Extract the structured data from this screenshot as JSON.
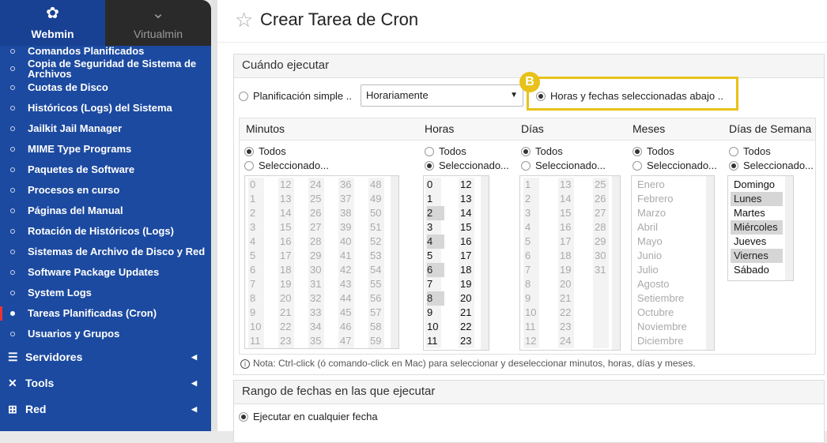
{
  "brand": {
    "webmin": "Webmin",
    "virtualmin": "Virtualmin"
  },
  "sidebar": {
    "items": [
      {
        "label": "Comandos Planificados"
      },
      {
        "label": "Copia de Seguridad de Sistema de Archivos"
      },
      {
        "label": "Cuotas de Disco"
      },
      {
        "label": "Históricos (Logs) del Sistema"
      },
      {
        "label": "Jailkit Jail Manager"
      },
      {
        "label": "MIME Type Programs"
      },
      {
        "label": "Paquetes de Software"
      },
      {
        "label": "Procesos en curso"
      },
      {
        "label": "Páginas del Manual"
      },
      {
        "label": "Rotación de Históricos (Logs)"
      },
      {
        "label": "Sistemas de Archivo de Disco y Red"
      },
      {
        "label": "Software Package Updates"
      },
      {
        "label": "System Logs"
      },
      {
        "label": "Tareas Planificadas (Cron)",
        "active": true
      },
      {
        "label": "Usuarios y Grupos"
      }
    ],
    "groups": [
      {
        "label": "Servidores",
        "icon": "server-icon"
      },
      {
        "label": "Tools",
        "icon": "tools-icon"
      },
      {
        "label": "Red",
        "icon": "network-icon"
      }
    ]
  },
  "page": {
    "title": "Crear Tarea de Cron"
  },
  "when": {
    "heading": "Cuándo ejecutar",
    "simple_label": "Planificación simple ..",
    "simple_value": "Horariamente",
    "selected_label": "Horas y fechas seleccionadas abajo ..",
    "badge": "B",
    "columns": {
      "minutes": "Minutos",
      "hours": "Horas",
      "days": "Días",
      "months": "Meses",
      "weekdays": "Días de Semana"
    },
    "todos": "Todos",
    "seleccionado": "Seleccionado...",
    "minutes_cols": [
      [
        "0",
        "1",
        "2",
        "3",
        "4",
        "5",
        "6",
        "7",
        "8",
        "9",
        "10",
        "11"
      ],
      [
        "12",
        "13",
        "14",
        "15",
        "16",
        "17",
        "18",
        "19",
        "20",
        "21",
        "22",
        "23"
      ],
      [
        "24",
        "25",
        "26",
        "27",
        "28",
        "29",
        "30",
        "31",
        "32",
        "33",
        "34",
        "35"
      ],
      [
        "36",
        "37",
        "38",
        "39",
        "40",
        "41",
        "42",
        "43",
        "44",
        "45",
        "46",
        "47"
      ],
      [
        "48",
        "49",
        "50",
        "51",
        "52",
        "53",
        "54",
        "55",
        "56",
        "57",
        "58",
        "59"
      ]
    ],
    "hours_cols": [
      [
        "0",
        "1",
        "2",
        "3",
        "4",
        "5",
        "6",
        "7",
        "8",
        "9",
        "10",
        "11"
      ],
      [
        "12",
        "13",
        "14",
        "15",
        "16",
        "17",
        "18",
        "19",
        "20",
        "21",
        "22",
        "23"
      ]
    ],
    "hours_selected": [
      "2",
      "4",
      "6",
      "8"
    ],
    "days_cols": [
      [
        "1",
        "2",
        "3",
        "4",
        "5",
        "6",
        "7",
        "8",
        "9",
        "10",
        "11",
        "12"
      ],
      [
        "13",
        "14",
        "15",
        "16",
        "17",
        "18",
        "19",
        "20",
        "21",
        "22",
        "23",
        "24"
      ],
      [
        "25",
        "26",
        "27",
        "28",
        "29",
        "30",
        "31"
      ]
    ],
    "months": [
      "Enero",
      "Febrero",
      "Marzo",
      "Abril",
      "Mayo",
      "Junio",
      "Julio",
      "Agosto",
      "Setiembre",
      "Octubre",
      "Noviembre",
      "Diciembre"
    ],
    "weekdays": [
      "Domingo",
      "Lunes",
      "Martes",
      "Miércoles",
      "Jueves",
      "Viernes",
      "Sábado"
    ],
    "weekdays_selected": [
      "Lunes",
      "Miércoles",
      "Viernes"
    ],
    "note": "Nota: Ctrl-click (ó comando-click en Mac) para seleccionar y deseleccionar minutos, horas, días y meses."
  },
  "range": {
    "heading": "Rango de fechas en las que ejecutar",
    "any_label": "Ejecutar en cualquier fecha"
  },
  "colors": {
    "sidebar": "#1c4aa0",
    "highlight": "#e8c21a"
  }
}
